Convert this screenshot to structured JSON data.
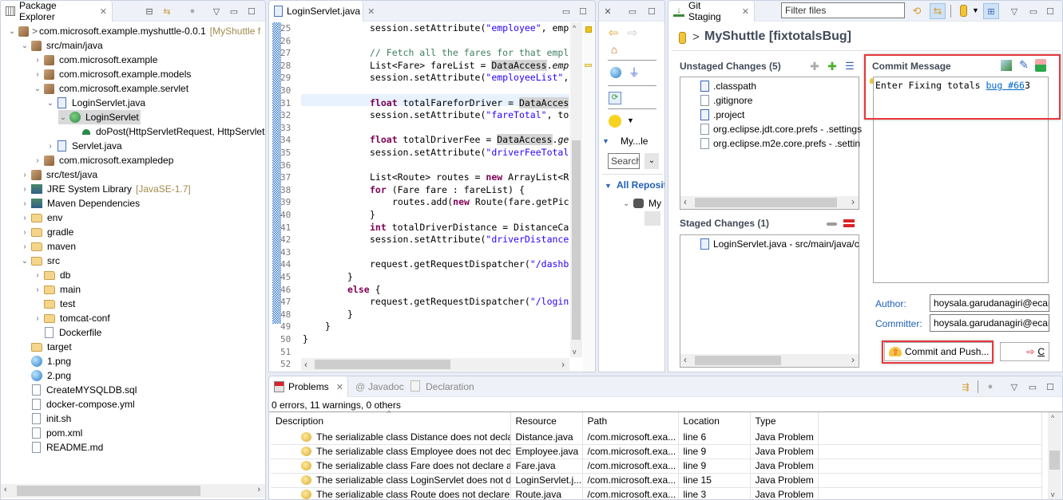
{
  "package_explorer": {
    "title": "Package Explorer",
    "tree": [
      {
        "label": "com.microsoft.example.myshuttle-0.0.1",
        "decoration": "[MyShuttle f",
        "prefix": ">",
        "level": 0,
        "expanded": true,
        "icon": "maven-project-icon"
      },
      {
        "label": "src/main/java",
        "level": 1,
        "expanded": true,
        "icon": "source-folder-icon"
      },
      {
        "label": "com.microsoft.example",
        "level": 2,
        "expanded": false,
        "icon": "package-icon"
      },
      {
        "label": "com.microsoft.example.models",
        "level": 2,
        "expanded": false,
        "icon": "package-icon"
      },
      {
        "label": "com.microsoft.example.servlet",
        "level": 2,
        "expanded": true,
        "icon": "package-icon"
      },
      {
        "label": "LoginServlet.java",
        "level": 3,
        "expanded": true,
        "icon": "java-file-icon"
      },
      {
        "label": "LoginServlet",
        "level": 4,
        "expanded": true,
        "icon": "class-icon",
        "selected": true
      },
      {
        "label": "doPost(HttpServletRequest, HttpServlet",
        "level": 5,
        "icon": "method-icon"
      },
      {
        "label": "Servlet.java",
        "level": 3,
        "expanded": false,
        "icon": "java-file-icon"
      },
      {
        "label": "com.microsoft.exampledep",
        "level": 2,
        "expanded": false,
        "icon": "package-icon"
      },
      {
        "label": "src/test/java",
        "level": 1,
        "expanded": false,
        "icon": "source-folder-icon"
      },
      {
        "label": "JRE System Library",
        "decoration": "[JavaSE-1.7]",
        "level": 1,
        "expanded": false,
        "icon": "library-icon"
      },
      {
        "label": "Maven Dependencies",
        "level": 1,
        "expanded": false,
        "icon": "library-icon"
      },
      {
        "label": "env",
        "level": 1,
        "expanded": false,
        "icon": "folder-icon"
      },
      {
        "label": "gradle",
        "level": 1,
        "expanded": false,
        "icon": "folder-icon"
      },
      {
        "label": "maven",
        "level": 1,
        "expanded": false,
        "icon": "folder-icon"
      },
      {
        "label": "src",
        "level": 1,
        "expanded": true,
        "icon": "folder-icon"
      },
      {
        "label": "db",
        "level": 2,
        "expanded": false,
        "icon": "folder-icon"
      },
      {
        "label": "main",
        "level": 2,
        "expanded": false,
        "icon": "folder-icon"
      },
      {
        "label": "test",
        "level": 2,
        "icon": "folder-icon"
      },
      {
        "label": "tomcat-conf",
        "level": 2,
        "expanded": false,
        "icon": "folder-icon"
      },
      {
        "label": "Dockerfile",
        "level": 2,
        "icon": "file-icon"
      },
      {
        "label": "target",
        "level": 1,
        "icon": "folder-icon"
      },
      {
        "label": "1.png",
        "level": 1,
        "icon": "image-icon"
      },
      {
        "label": "2.png",
        "level": 1,
        "icon": "image-icon"
      },
      {
        "label": "CreateMYSQLDB.sql",
        "level": 1,
        "icon": "file-icon"
      },
      {
        "label": "docker-compose.yml",
        "level": 1,
        "icon": "file-icon"
      },
      {
        "label": "init.sh",
        "level": 1,
        "icon": "script-icon"
      },
      {
        "label": "pom.xml",
        "level": 1,
        "icon": "pom-icon"
      },
      {
        "label": "README.md",
        "level": 1,
        "icon": "file-icon"
      }
    ]
  },
  "editor": {
    "tab_label": "LoginServlet.java",
    "lines": [
      {
        "n": "25",
        "indent": 3,
        "parts": [
          [
            "",
            "session.setAttribute("
          ],
          [
            "str",
            "\"employee\""
          ],
          [
            "",
            ", emp"
          ]
        ]
      },
      {
        "n": "26",
        "indent": 0,
        "parts": []
      },
      {
        "n": "27",
        "indent": 3,
        "parts": [
          [
            "com",
            "// Fetch all the fares for that empl"
          ]
        ]
      },
      {
        "n": "28",
        "indent": 3,
        "parts": [
          [
            "",
            "List<Fare> fareList = "
          ],
          [
            "hl",
            "DataAccess"
          ],
          [
            "",
            "."
          ],
          [
            "it",
            "emp"
          ]
        ]
      },
      {
        "n": "29",
        "indent": 3,
        "parts": [
          [
            "",
            "session.setAttribute("
          ],
          [
            "str",
            "\"employeeList\""
          ],
          [
            "",
            ","
          ]
        ]
      },
      {
        "n": "30",
        "indent": 0,
        "parts": []
      },
      {
        "n": "31",
        "indent": 3,
        "parts": [
          [
            "kw",
            "float"
          ],
          [
            "",
            " totalFareforDriver = "
          ],
          [
            "hl",
            "DataAcces"
          ]
        ]
      },
      {
        "n": "32",
        "indent": 3,
        "parts": [
          [
            "",
            "session.setAttribute("
          ],
          [
            "str",
            "\"fareTotal\""
          ],
          [
            "",
            ", to"
          ]
        ]
      },
      {
        "n": "33",
        "indent": 0,
        "parts": []
      },
      {
        "n": "34",
        "indent": 3,
        "parts": [
          [
            "kw",
            "float"
          ],
          [
            "",
            " totalDriverFee = "
          ],
          [
            "hl",
            "DataAccess"
          ],
          [
            "",
            "."
          ],
          [
            "it",
            "ge"
          ]
        ]
      },
      {
        "n": "35",
        "indent": 3,
        "parts": [
          [
            "",
            "session.setAttribute("
          ],
          [
            "str",
            "\"driverFeeTotal"
          ]
        ]
      },
      {
        "n": "36",
        "indent": 0,
        "parts": []
      },
      {
        "n": "37",
        "indent": 3,
        "parts": [
          [
            "",
            "List<Route> routes = "
          ],
          [
            "kw",
            "new"
          ],
          [
            "",
            " ArrayList<R"
          ]
        ]
      },
      {
        "n": "38",
        "indent": 3,
        "parts": [
          [
            "kw",
            "for"
          ],
          [
            "",
            " (Fare fare : fareList) {"
          ]
        ]
      },
      {
        "n": "39",
        "indent": 4,
        "parts": [
          [
            "",
            "routes.add("
          ],
          [
            "kw",
            "new"
          ],
          [
            "",
            " Route(fare.getPic"
          ]
        ]
      },
      {
        "n": "40",
        "indent": 3,
        "parts": [
          [
            "",
            "}"
          ]
        ]
      },
      {
        "n": "41",
        "indent": 3,
        "parts": [
          [
            "kw",
            "int"
          ],
          [
            "",
            " totalDriverDistance = DistanceCa"
          ]
        ]
      },
      {
        "n": "42",
        "indent": 3,
        "parts": [
          [
            "",
            "session.setAttribute("
          ],
          [
            "str",
            "\"driverDistance"
          ]
        ]
      },
      {
        "n": "43",
        "indent": 0,
        "parts": []
      },
      {
        "n": "44",
        "indent": 3,
        "parts": [
          [
            "",
            "request.getRequestDispatcher("
          ],
          [
            "str",
            "\"/dashb"
          ]
        ]
      },
      {
        "n": "45",
        "indent": 2,
        "parts": [
          [
            "",
            "}"
          ]
        ]
      },
      {
        "n": "46",
        "indent": 2,
        "parts": [
          [
            "kw",
            "else"
          ],
          [
            "",
            " {"
          ]
        ]
      },
      {
        "n": "47",
        "indent": 3,
        "parts": [
          [
            "",
            "request.getRequestDispatcher("
          ],
          [
            "str",
            "\"/login"
          ]
        ]
      },
      {
        "n": "48",
        "indent": 2,
        "parts": [
          [
            "",
            "}"
          ]
        ]
      },
      {
        "n": "49",
        "indent": 1,
        "parts": [
          [
            "",
            "}"
          ]
        ]
      },
      {
        "n": "50",
        "indent": 0,
        "parts": [
          [
            "",
            "}"
          ]
        ]
      },
      {
        "n": "51",
        "indent": 0,
        "parts": []
      },
      {
        "n": "52",
        "indent": 0,
        "parts": []
      }
    ]
  },
  "middle_view": {
    "project_label": "My...le",
    "search_placeholder": "Search",
    "all_repositories": "All Reposit",
    "repo_item": "My"
  },
  "git_staging": {
    "tab_label": "Git Staging",
    "filter_placeholder": "Filter files",
    "repo_title": "MyShuttle [fixtotalsBug]",
    "repo_prefix": ">",
    "unstaged_title": "Unstaged Changes (5)",
    "unstaged": [
      {
        "name": ".classpath",
        "icon": "xml-file-icon"
      },
      {
        "name": ".gitignore",
        "icon": "text-file-icon"
      },
      {
        "name": ".project",
        "icon": "xml-file-icon"
      },
      {
        "name": "org.eclipse.jdt.core.prefs - .settings",
        "icon": "text-file-icon"
      },
      {
        "name": "org.eclipse.m2e.core.prefs - .settin",
        "icon": "text-file-icon"
      }
    ],
    "staged_title": "Staged Changes (1)",
    "staged": [
      {
        "name": "LoginServlet.java - src/main/java/c",
        "icon": "java-file-icon"
      }
    ],
    "commit_message_title": "Commit Message",
    "commit_message_prefix": "Enter Fixing totals ",
    "commit_message_link": "bug #66",
    "commit_message_suffix": "3",
    "author_label": "Author:",
    "author_value": "hoysala.garudanagiri@ecar",
    "committer_label": "Committer:",
    "committer_value": "hoysala.garudanagiri@ecar",
    "commit_push_label": "Commit and Push...",
    "commit_label": "C"
  },
  "problems": {
    "tabs": [
      "Problems",
      "Javadoc",
      "Declaration"
    ],
    "summary": "0 errors, 11 warnings, 0 others",
    "columns": [
      "Description",
      "Resource",
      "Path",
      "Location",
      "Type"
    ],
    "rows": [
      [
        "The serializable class Distance does not declare",
        "Distance.java",
        "/com.microsoft.exa...",
        "line 6",
        "Java Problem"
      ],
      [
        "The serializable class Employee does not decla",
        "Employee.java",
        "/com.microsoft.exa...",
        "line 9",
        "Java Problem"
      ],
      [
        "The serializable class Fare does not declare a st",
        "Fare.java",
        "/com.microsoft.exa...",
        "line 9",
        "Java Problem"
      ],
      [
        "The serializable class LoginServlet does not dec",
        "LoginServlet.j...",
        "/com.microsoft.exa...",
        "line 15",
        "Java Problem"
      ],
      [
        "The serializable class Route does not declare a",
        "Route.java",
        "/com.microsoft.exa...",
        "line 3",
        "Java Problem"
      ]
    ]
  },
  "colors": {
    "highlight_red": "#e5383b",
    "link_blue": "#0066cc",
    "selection_gray": "#d9d9d9"
  }
}
